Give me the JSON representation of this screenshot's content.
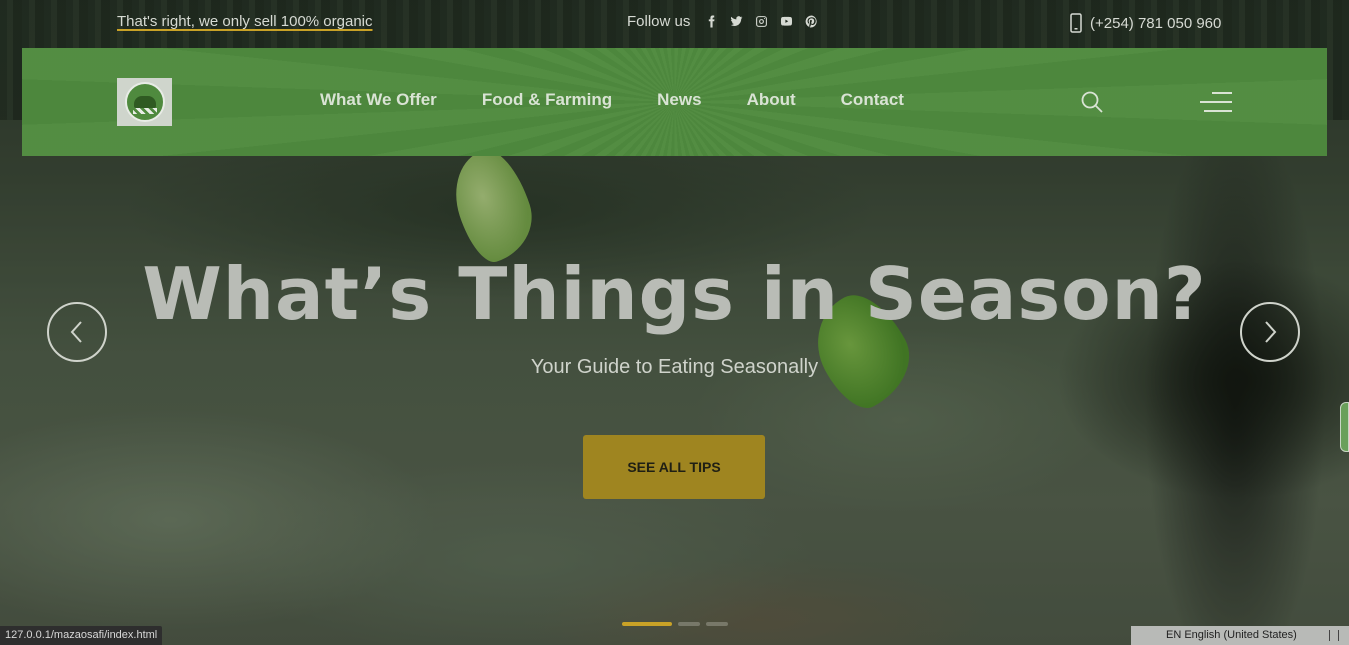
{
  "topbar": {
    "promo_text": "That's right, we only sell 100% organic",
    "follow_label": "Follow us",
    "socials": [
      "facebook-icon",
      "twitter-icon",
      "instagram-icon",
      "youtube-icon",
      "pinterest-icon"
    ],
    "phone": "(+254) 781 050 960"
  },
  "nav": {
    "items": [
      "What We Offer",
      "Food & Farming",
      "News",
      "About",
      "Contact"
    ]
  },
  "hero": {
    "title": "What’s Things in Season?",
    "subtitle": "Your Guide to Eating Seasonally",
    "button_label": "SEE ALL TIPS",
    "slide_count": 3,
    "active_slide": 1
  },
  "statusbar": {
    "url": "127.0.0.1/mazaosafi/index.html",
    "language": "EN English (United States)"
  },
  "colors": {
    "nav_green": "#4f8a3e",
    "accent_gold": "#c9a227",
    "button_gold": "#9f8520"
  }
}
